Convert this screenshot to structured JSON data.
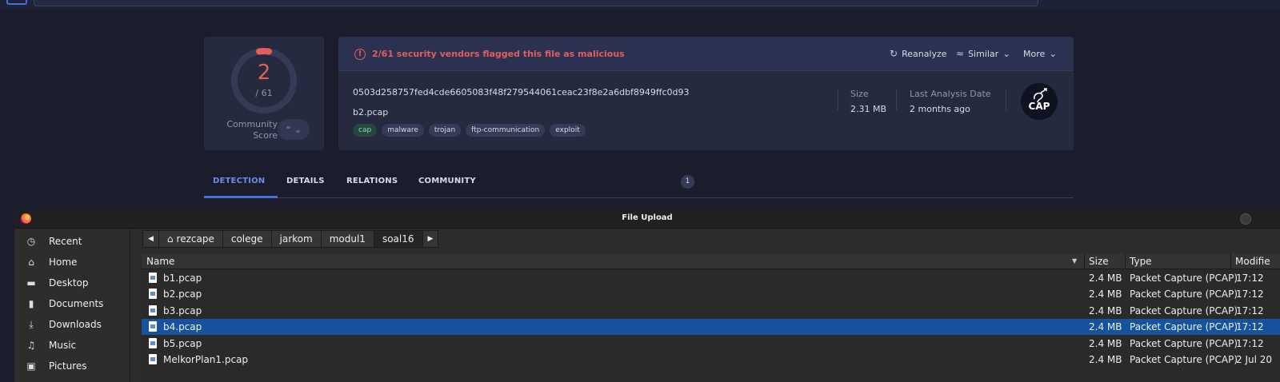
{
  "vt": {
    "score": {
      "detections": "2",
      "total": "/ 61",
      "community_label": "Community Score"
    },
    "alert": "2/61 security vendors flagged this file as malicious",
    "actions": {
      "reanalyze": "Reanalyze",
      "similar": "Similar",
      "more": "More"
    },
    "file": {
      "hash": "0503d258757fed4cde6605083f48f279544061ceac23f8e2a6dbf8949ffc0d93",
      "name": "b2.pcap",
      "tags": [
        "cap",
        "malware",
        "trojan",
        "ftp-communication",
        "exploit"
      ],
      "size_label": "Size",
      "size_value": "2.31 MB",
      "date_label": "Last Analysis Date",
      "date_value": "2 months ago",
      "type_badge": "CAP"
    },
    "tabs": {
      "detection": "DETECTION",
      "details": "DETAILS",
      "relations": "RELATIONS",
      "community": "COMMUNITY",
      "community_count": "1"
    },
    "colors": {
      "accent": "#4a6fd8",
      "malicious": "#e35d5d"
    }
  },
  "dialog": {
    "title": "File Upload",
    "sidebar": [
      {
        "label": "Recent",
        "icon": "clock-icon"
      },
      {
        "label": "Home",
        "icon": "home-icon"
      },
      {
        "label": "Desktop",
        "icon": "desktop-icon"
      },
      {
        "label": "Documents",
        "icon": "document-icon"
      },
      {
        "label": "Downloads",
        "icon": "download-icon"
      },
      {
        "label": "Music",
        "icon": "music-icon"
      },
      {
        "label": "Pictures",
        "icon": "picture-icon"
      }
    ],
    "path": [
      "rezcape",
      "colege",
      "jarkom",
      "modul1",
      "soal16"
    ],
    "columns": {
      "name": "Name",
      "size": "Size",
      "type": "Type",
      "modified": "Modifie"
    },
    "files": [
      {
        "name": "b1.pcap",
        "size": "2.4 MB",
        "type": "Packet Capture (PCAP)",
        "modified": "17:12"
      },
      {
        "name": "b2.pcap",
        "size": "2.4 MB",
        "type": "Packet Capture (PCAP)",
        "modified": "17:12"
      },
      {
        "name": "b3.pcap",
        "size": "2.4 MB",
        "type": "Packet Capture (PCAP)",
        "modified": "17:12"
      },
      {
        "name": "b4.pcap",
        "size": "2.4 MB",
        "type": "Packet Capture (PCAP)",
        "modified": "17:12"
      },
      {
        "name": "b5.pcap",
        "size": "2.4 MB",
        "type": "Packet Capture (PCAP)",
        "modified": "17:12"
      },
      {
        "name": "MelkorPlan1.pcap",
        "size": "2.4 MB",
        "type": "Packet Capture (PCAP)",
        "modified": "2 Jul 20"
      }
    ],
    "selected_file": "b4.pcap",
    "colors": {
      "selection": "#15539e"
    }
  }
}
